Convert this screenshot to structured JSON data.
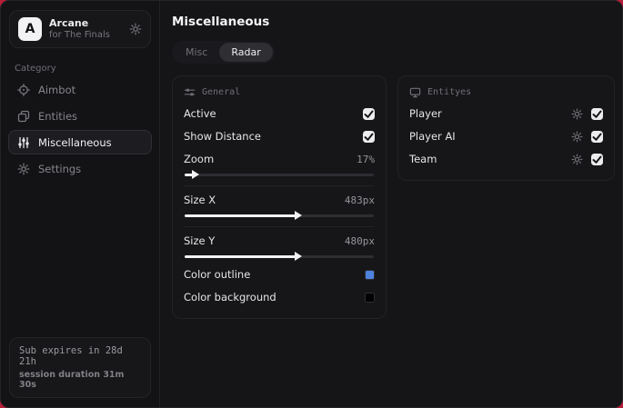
{
  "colors": {
    "backdrop": "#b81e38",
    "window_bg": "#131316",
    "outline_swatch": "#4d82dd",
    "background_swatch": "#000000"
  },
  "sidebar": {
    "brand": {
      "logo_letter": "A",
      "title": "Arcane",
      "subtitle": "for The Finals",
      "action_icon": "gear-icon"
    },
    "category_label": "Category",
    "items": [
      {
        "label": "Aimbot",
        "icon": "crosshair-icon",
        "active": false
      },
      {
        "label": "Entities",
        "icon": "stack-icon",
        "active": false
      },
      {
        "label": "Miscellaneous",
        "icon": "sliders-vertical-icon",
        "active": true
      },
      {
        "label": "Settings",
        "icon": "gear-icon",
        "active": false
      }
    ],
    "footer": {
      "line1": "Sub expires in 28d 21h",
      "line2": "session duration 31m 30s"
    }
  },
  "main": {
    "title": "Miscellaneous",
    "tabs": [
      {
        "label": "Misc",
        "active": false
      },
      {
        "label": "Radar",
        "active": true
      }
    ],
    "general_panel": {
      "title": "General",
      "icon": "sliders-horizontal-icon",
      "toggles": [
        {
          "label": "Active",
          "checked": true
        },
        {
          "label": "Show Distance",
          "checked": true
        }
      ],
      "sliders": [
        {
          "label": "Zoom",
          "value": "17%",
          "fill_pct": 6
        },
        {
          "label": "Size X",
          "value": "483px",
          "fill_pct": 60
        },
        {
          "label": "Size Y",
          "value": "480px",
          "fill_pct": 60
        }
      ],
      "color_rows": [
        {
          "label": "Color outline",
          "color": "#4d82dd"
        },
        {
          "label": "Color background",
          "color": "#000000"
        }
      ]
    },
    "entities_panel": {
      "title": "Entityes",
      "icon": "monitor-icon",
      "rows": [
        {
          "label": "Player",
          "checked": true
        },
        {
          "label": "Player AI",
          "checked": true
        },
        {
          "label": "Team",
          "checked": true
        }
      ]
    }
  }
}
